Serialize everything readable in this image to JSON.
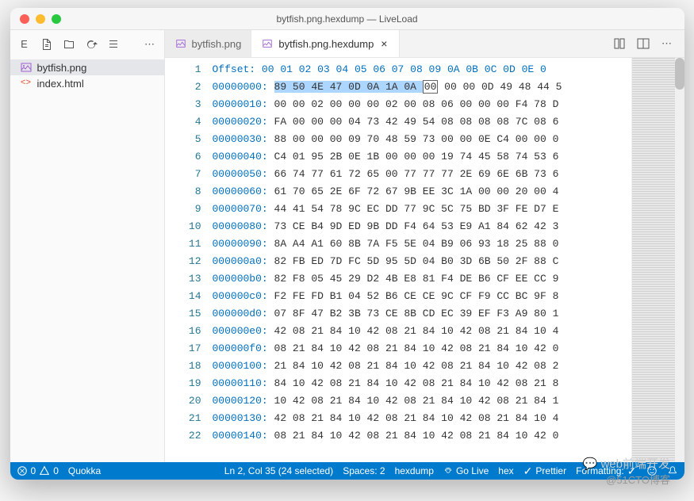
{
  "window": {
    "title": "bytfish.png.hexdump — LiveLoad"
  },
  "sidebar": {
    "files": [
      {
        "name": "bytfish.png",
        "icon": "image",
        "selected": true
      },
      {
        "name": "index.html",
        "icon": "html",
        "selected": false
      }
    ]
  },
  "tabs": [
    {
      "label": "bytfish.png",
      "icon": "image",
      "active": false
    },
    {
      "label": "bytfish.png.hexdump",
      "icon": "file",
      "active": true
    }
  ],
  "hex": {
    "header": {
      "label": "Offset:",
      "cols": "00 01 02 03 04 05 06 07 08 09 0A 0B 0C 0D 0E 0"
    },
    "rows": [
      {
        "n": 1,
        "offset": "00000000:",
        "bytes": "89 50 4E 47 0D 0A 1A 0A 00 00 00 0D 49 48 44 5",
        "selStart": 0,
        "selEnd": 8
      },
      {
        "n": 2,
        "offset": "00000010:",
        "bytes": "00 00 02 00 00 00 02 00 08 06 00 00 00 F4 78 D"
      },
      {
        "n": 3,
        "offset": "00000020:",
        "bytes": "FA 00 00 00 04 73 42 49 54 08 08 08 08 7C 08 6"
      },
      {
        "n": 4,
        "offset": "00000030:",
        "bytes": "88 00 00 00 09 70 48 59 73 00 00 0E C4 00 00 0"
      },
      {
        "n": 5,
        "offset": "00000040:",
        "bytes": "C4 01 95 2B 0E 1B 00 00 00 19 74 45 58 74 53 6"
      },
      {
        "n": 6,
        "offset": "00000050:",
        "bytes": "66 74 77 61 72 65 00 77 77 77 2E 69 6E 6B 73 6"
      },
      {
        "n": 7,
        "offset": "00000060:",
        "bytes": "61 70 65 2E 6F 72 67 9B EE 3C 1A 00 00 20 00 4"
      },
      {
        "n": 8,
        "offset": "00000070:",
        "bytes": "44 41 54 78 9C EC DD 77 9C 5C 75 BD 3F FE D7 E"
      },
      {
        "n": 9,
        "offset": "00000080:",
        "bytes": "73 CE B4 9D ED 9B DD F4 64 53 E9 A1 84 62 42 3"
      },
      {
        "n": 10,
        "offset": "00000090:",
        "bytes": "8A A4 A1 60 8B 7A F5 5E 04 B9 06 93 18 25 88 0"
      },
      {
        "n": 11,
        "offset": "000000a0:",
        "bytes": "82 FB ED 7D FC 5D 95 5D 04 B0 3D 6B 50 2F 88 C"
      },
      {
        "n": 12,
        "offset": "000000b0:",
        "bytes": "82 F8 05 45 29 D2 4B E8 81 F4 DE B6 CF EE CC 9"
      },
      {
        "n": 13,
        "offset": "000000c0:",
        "bytes": "F2 FE FD B1 04 52 B6 CE CE 9C CF F9 CC BC 9F 8"
      },
      {
        "n": 14,
        "offset": "000000d0:",
        "bytes": "07 8F 47 B2 3B 73 CE 8B CD EC 39 EF F3 A9 80 1"
      },
      {
        "n": 15,
        "offset": "000000e0:",
        "bytes": "42 08 21 84 10 42 08 21 84 10 42 08 21 84 10 4"
      },
      {
        "n": 16,
        "offset": "000000f0:",
        "bytes": "08 21 84 10 42 08 21 84 10 42 08 21 84 10 42 0"
      },
      {
        "n": 17,
        "offset": "00000100:",
        "bytes": "21 84 10 42 08 21 84 10 42 08 21 84 10 42 08 2"
      },
      {
        "n": 18,
        "offset": "00000110:",
        "bytes": "84 10 42 08 21 84 10 42 08 21 84 10 42 08 21 8"
      },
      {
        "n": 19,
        "offset": "00000120:",
        "bytes": "10 42 08 21 84 10 42 08 21 84 10 42 08 21 84 1"
      },
      {
        "n": 20,
        "offset": "00000130:",
        "bytes": "42 08 21 84 10 42 08 21 84 10 42 08 21 84 10 4"
      },
      {
        "n": 21,
        "offset": "00000140:",
        "bytes": "08 21 84 10 42 08 21 84 10 42 08 21 84 10 42 0"
      }
    ]
  },
  "status": {
    "errors": "0",
    "warnings": "0",
    "quokka": "Quokka",
    "cursor": "Ln 2, Col 35 (24 selected)",
    "spaces": "Spaces: 2",
    "lang": "hexdump",
    "golive": "Go Live",
    "mode": "hex",
    "prettier": "Prettier",
    "formatting": "Formatting:"
  },
  "watermark": {
    "line1": "web前端开发",
    "line2": "@51CTO博客"
  }
}
